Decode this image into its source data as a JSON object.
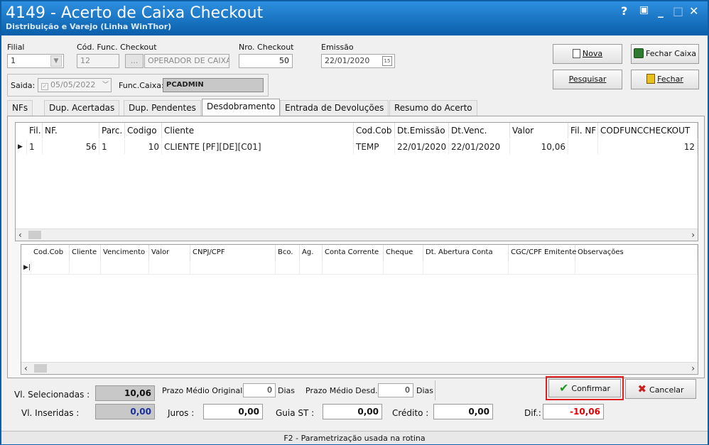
{
  "window": {
    "title": "4149 - Acerto de Caixa Checkout",
    "subtitle": "Distribuição e Varejo (Linha WinThor)",
    "controls": [
      "?",
      "▣",
      "_",
      "□",
      "✕"
    ]
  },
  "filters": {
    "filial_label": "Filial",
    "filial_value": "1",
    "cod_func_label": "Cód. Func. Checkout",
    "cod_func_value": "12",
    "lookup_button": "...",
    "operador_value": "OPERADOR DE CAIXA",
    "nro_checkout_label": "Nro. Checkout",
    "nro_checkout_value": "50",
    "emissao_label": "Emissão",
    "emissao_value": "22/01/2020",
    "saida_label": "Saida:",
    "saida_value": "05/05/2022",
    "func_caixa_label": "Func.Caixa:",
    "func_caixa_value": "PCADMIN"
  },
  "buttons": {
    "nova": "Nova",
    "fechar_caixa": "Fechar Caixa",
    "pesquisar": "Pesquisar",
    "fechar": "Fechar",
    "confirmar": "Confirmar",
    "cancelar": "Cancelar"
  },
  "tabs": [
    "NFs",
    "Dup. Acertadas",
    "Dup. Pendentes",
    "Desdobramento",
    "Entrada de Devoluções",
    "Resumo do Acerto"
  ],
  "active_tab": "Desdobramento",
  "grid_top": {
    "columns": [
      "Fil.",
      "NF.",
      "Parc.",
      "Codigo",
      "Cliente",
      "Cod.Cob",
      "Dt.Emissão",
      "Dt.Venc.",
      "Valor",
      "Fil. NF",
      "CODFUNCCHECKOUT"
    ],
    "rows": [
      [
        "1",
        "56",
        "1",
        "10",
        "CLIENTE [PF][DE][C01]",
        "TEMP",
        "22/01/2020",
        "22/01/2020",
        "10,06",
        "",
        "12"
      ]
    ]
  },
  "grid_bottom": {
    "columns": [
      "Cod.Cob",
      "Cliente",
      "Vencimento",
      "Valor",
      "CNPJ/CPF",
      "Bco.",
      "Ag.",
      "Conta Corrente",
      "Cheque",
      "Dt. Abertura Conta",
      "CGC/CPF Emitente",
      "Observações"
    ],
    "rows": []
  },
  "totals": {
    "vl_selecionadas_label": "Vl. Selecionadas :",
    "vl_selecionadas_value": "10,06",
    "vl_inseridas_label": "Vl. Inseridas :",
    "vl_inseridas_value": "0,00",
    "prazo_original_label": "Prazo Médio Original",
    "prazo_original_value": "0",
    "prazo_original_unit": "Dias",
    "prazo_desd_label": "Prazo Médio Desd.",
    "prazo_desd_value": "0",
    "prazo_desd_unit": "Dias",
    "juros_label": "Juros :",
    "juros_value": "0,00",
    "guia_st_label": "Guia ST :",
    "guia_st_value": "0,00",
    "credito_label": "Crédito :",
    "credito_value": "0,00",
    "dif_label": "Dif.:",
    "dif_value": "-10,06"
  },
  "status_bar": "F2 - Parametrização usada na rotina",
  "colors": {
    "title_bar": "#1a76c8",
    "dif_text": "#e00000",
    "inseridas_text": "#1a2fa0",
    "confirm_highlight": "#e02020",
    "confirm_icon": "#1e9a1e",
    "cancel_icon": "#c82020"
  }
}
